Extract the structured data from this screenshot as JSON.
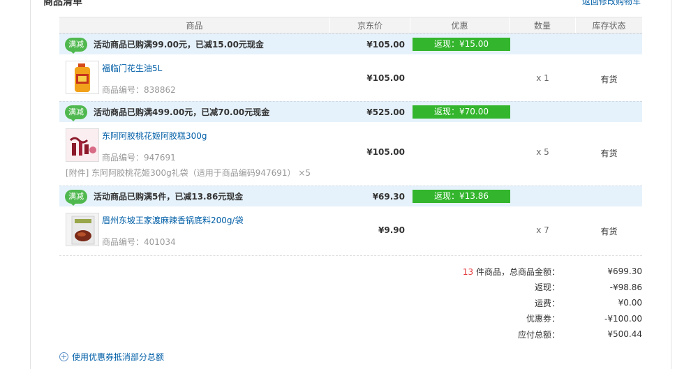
{
  "header": {
    "title": "商品清单",
    "back_link": "返回修改购物车"
  },
  "table": {
    "columns": [
      "商品",
      "京东价",
      "优惠",
      "数量",
      "库存状态"
    ],
    "groups": [
      {
        "badge": "满减",
        "promo_text": "活动商品已购满99.00元，已减15.00元现金",
        "promo_price": "¥105.00",
        "promo_tag": "返现：¥15.00",
        "items": [
          {
            "name": "福临门花生油5L",
            "sku": "商品编号：838862",
            "price": "¥105.00",
            "qty": "x 1",
            "stock": "有货"
          }
        ]
      },
      {
        "badge": "满减",
        "promo_text": "活动商品已购满499.00元，已减70.00元现金",
        "promo_price": "¥525.00",
        "promo_tag": "返现：¥70.00",
        "items": [
          {
            "name": "东阿阿胶桃花姬阿胶糕300g",
            "sku": "商品编号：947691",
            "price": "¥105.00",
            "qty": "x 5",
            "stock": "有货",
            "accessory": "[附件] 东阿阿胶桃花姬300g礼袋（适用于商品编码947691） ×5"
          }
        ]
      },
      {
        "badge": "满减",
        "promo_text": "活动商品已购满5件，已减13.86元现金",
        "promo_price": "¥69.30",
        "promo_tag": "返现：¥13.86",
        "items": [
          {
            "name": "眉州东坡王家渡麻辣香锅底料200g/袋",
            "sku": "商品编号：401034",
            "price": "¥9.90",
            "qty": "x 7",
            "stock": "有货"
          }
        ]
      }
    ]
  },
  "summary": {
    "count": "13",
    "count_label": " 件商品，总商品金额：",
    "goods_total": "¥699.30",
    "rebate_label": "返现：",
    "rebate": "-¥98.86",
    "shipping_label": "运费：",
    "shipping": "¥0.00",
    "coupon_label": "优惠券：",
    "coupon": "-¥100.00",
    "payable_label": "应付总额：",
    "payable": "¥500.44"
  },
  "coupon_link": "使用优惠券抵消部分总额",
  "colors": {
    "link": "#005ea7",
    "promo_bg": "#e6f2fb",
    "rebate_green": "#33b52d",
    "badge_green": "#4fb84f",
    "accent_red": "#e4393c"
  }
}
